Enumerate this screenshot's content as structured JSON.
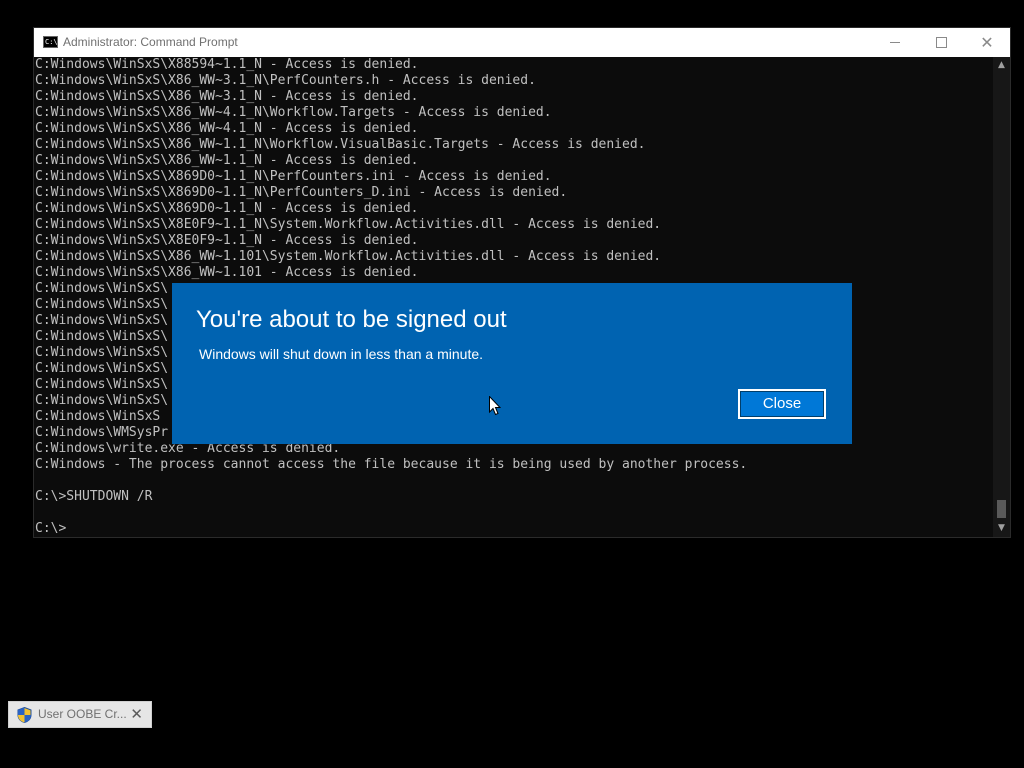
{
  "window": {
    "title": "Administrator: Command Prompt",
    "icon": "console-icon",
    "icon_text": "C:\\",
    "buttons": {
      "minimize": "minimize-icon",
      "maximize": "maximize-icon",
      "close": "✕"
    }
  },
  "console": {
    "lines": [
      "C:Windows\\WinSxS\\X88594~1.1_N - Access is denied.",
      "C:Windows\\WinSxS\\X86_WW~3.1_N\\PerfCounters.h - Access is denied.",
      "C:Windows\\WinSxS\\X86_WW~3.1_N - Access is denied.",
      "C:Windows\\WinSxS\\X86_WW~4.1_N\\Workflow.Targets - Access is denied.",
      "C:Windows\\WinSxS\\X86_WW~4.1_N - Access is denied.",
      "C:Windows\\WinSxS\\X86_WW~1.1_N\\Workflow.VisualBasic.Targets - Access is denied.",
      "C:Windows\\WinSxS\\X86_WW~1.1_N - Access is denied.",
      "C:Windows\\WinSxS\\X869D0~1.1_N\\PerfCounters.ini - Access is denied.",
      "C:Windows\\WinSxS\\X869D0~1.1_N\\PerfCounters_D.ini - Access is denied.",
      "C:Windows\\WinSxS\\X869D0~1.1_N - Access is denied.",
      "C:Windows\\WinSxS\\X8E0F9~1.1_N\\System.Workflow.Activities.dll - Access is denied.",
      "C:Windows\\WinSxS\\X8E0F9~1.1_N - Access is denied.",
      "C:Windows\\WinSxS\\X86_WW~1.101\\System.Workflow.Activities.dll - Access is denied.",
      "C:Windows\\WinSxS\\X86_WW~1.101 - Access is denied.",
      "C:Windows\\WinSxS\\",
      "C:Windows\\WinSxS\\",
      "C:Windows\\WinSxS\\",
      "C:Windows\\WinSxS\\",
      "C:Windows\\WinSxS\\",
      "C:Windows\\WinSxS\\",
      "C:Windows\\WinSxS\\",
      "C:Windows\\WinSxS\\",
      "C:Windows\\WinSxS",
      "C:Windows\\WMSysPr",
      "C:Windows\\write.exe - Access is denied.",
      "C:Windows - The process cannot access the file because it is being used by another process.",
      "",
      "C:\\>SHUTDOWN /R",
      "",
      "C:\\>"
    ]
  },
  "scrollbar": {
    "up_icon": "▲",
    "down_icon": "▼"
  },
  "dialog": {
    "title": "You're about to be signed out",
    "message": "Windows will shut down in less than a minute.",
    "close_label": "Close",
    "background": "#0063b1"
  },
  "taskbar_item": {
    "icon": "uac-shield-icon",
    "label": "User OOBE Cr...",
    "close": "✕"
  }
}
